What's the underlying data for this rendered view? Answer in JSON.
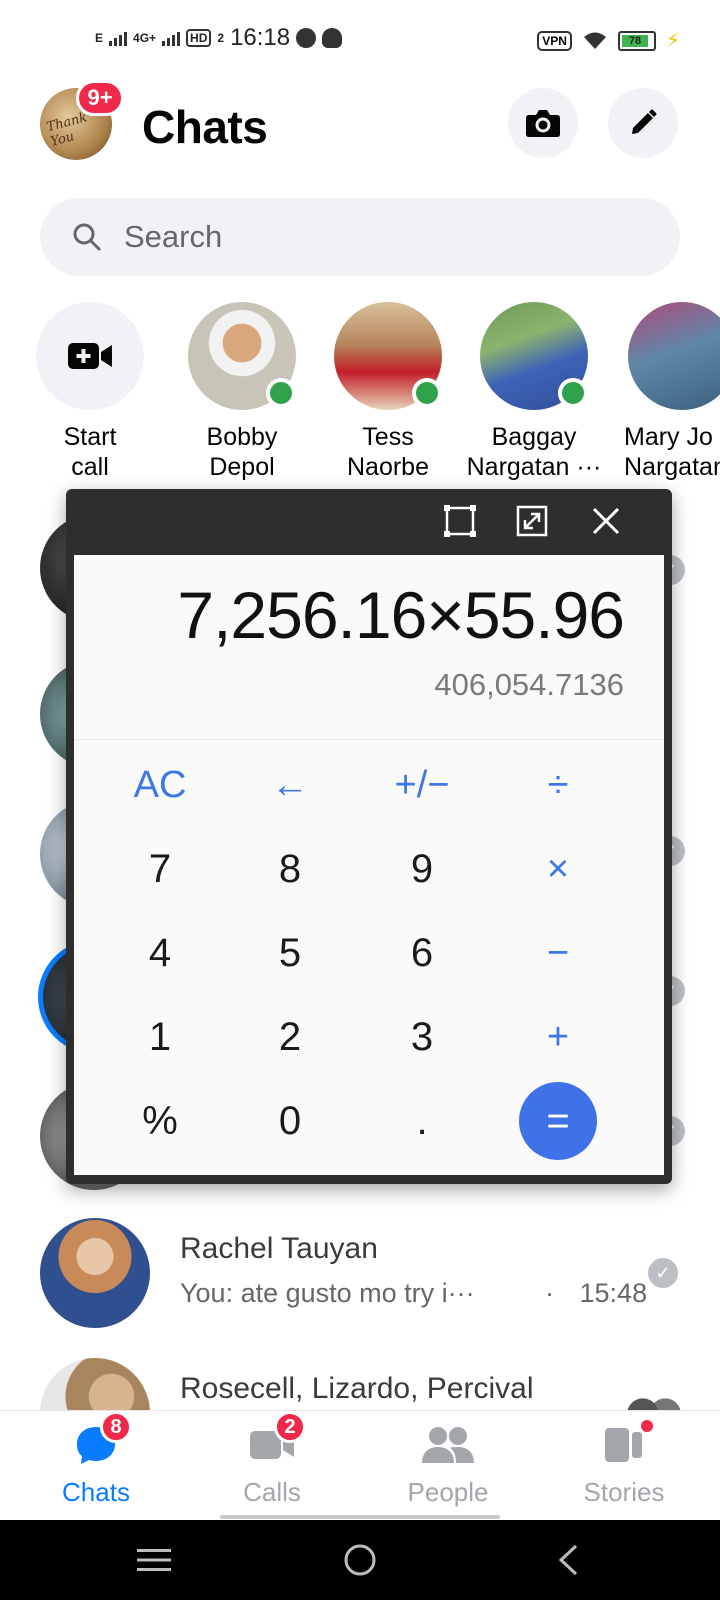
{
  "status_bar": {
    "network_small": "E",
    "network_type": "4G+",
    "hd_label": "HD",
    "hd_sub": "2",
    "time": "16:18",
    "vpn_label": "VPN",
    "battery": "78"
  },
  "header": {
    "title": "Chats",
    "me_badge": "9+",
    "avatar_text": "Thank You"
  },
  "search": {
    "placeholder": "Search"
  },
  "stories": [
    {
      "line1": "Start",
      "line2": "call"
    },
    {
      "line1": "Bobby",
      "line2": "Depol"
    },
    {
      "line1": "Tess",
      "line2": "Naorbe"
    },
    {
      "line1": "Baggay",
      "line2": "Nargatan ···"
    },
    {
      "line1": "Mary Jo",
      "line2": "Nargatan"
    }
  ],
  "chats": [
    {
      "name": "Rachel Tauyan",
      "preview": "You: ate gusto mo try i···",
      "dot": "·",
      "time": "15:48"
    },
    {
      "name": "Rosecell, Lizardo, Percival"
    }
  ],
  "calculator": {
    "expression": "7,256.16×55.96",
    "result": "406,054.7136",
    "keys": {
      "ac": "AC",
      "back": "←",
      "sign": "+/−",
      "divide": "÷",
      "k7": "7",
      "k8": "8",
      "k9": "9",
      "multiply": "×",
      "k4": "4",
      "k5": "5",
      "k6": "6",
      "minus": "−",
      "k1": "1",
      "k2": "2",
      "k3": "3",
      "plus": "+",
      "percent": "%",
      "k0": "0",
      "dot": ".",
      "equals": "="
    }
  },
  "bottom_nav": {
    "chats": "Chats",
    "chats_badge": "8",
    "calls": "Calls",
    "calls_badge": "2",
    "people": "People",
    "stories": "Stories"
  },
  "colors": {
    "accent": "#0a7cff",
    "badge": "#f02849",
    "online": "#31a24c",
    "calc_operator": "#3d78e6",
    "calc_equals": "#3f71e8"
  }
}
